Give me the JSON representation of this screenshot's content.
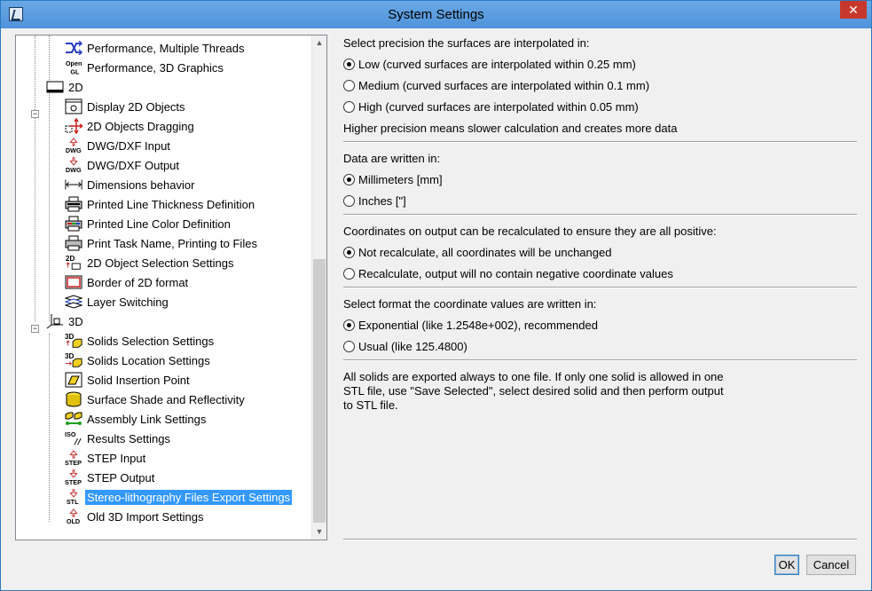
{
  "window": {
    "title": "System Settings",
    "close_glyph": "✕"
  },
  "tree": {
    "items": [
      {
        "label": "Performance, Multiple Threads",
        "icon": "threads-icon"
      },
      {
        "label": "Performance, 3D Graphics",
        "icon": "opengl-icon"
      },
      {
        "label": "2D",
        "icon": "folder-2d-icon",
        "group": true
      },
      {
        "label": "Display 2D Objects",
        "icon": "display-2d-icon"
      },
      {
        "label": "2D Objects Dragging",
        "icon": "dragging-icon"
      },
      {
        "label": "DWG/DXF Input",
        "icon": "dwg-input-icon"
      },
      {
        "label": "DWG/DXF Output",
        "icon": "dwg-output-icon"
      },
      {
        "label": "Dimensions behavior",
        "icon": "dimensions-icon"
      },
      {
        "label": "Printed Line Thickness Definition",
        "icon": "printer-icon"
      },
      {
        "label": "Printed Line Color Definition",
        "icon": "printer-color-icon"
      },
      {
        "label": "Print Task Name, Printing to Files",
        "icon": "printer-file-icon"
      },
      {
        "label": "2D Object Selection Settings",
        "icon": "selection-2d-icon"
      },
      {
        "label": "Border of 2D format",
        "icon": "border-icon"
      },
      {
        "label": "Layer Switching",
        "icon": "layers-icon"
      },
      {
        "label": "3D",
        "icon": "axes-3d-icon",
        "group": true
      },
      {
        "label": "Solids Selection Settings",
        "icon": "solid-select-icon"
      },
      {
        "label": "Solids Location Settings",
        "icon": "solid-location-icon"
      },
      {
        "label": "Solid Insertion Point",
        "icon": "insertion-point-icon"
      },
      {
        "label": "Surface Shade and Reflectivity",
        "icon": "shade-icon"
      },
      {
        "label": "Assembly Link Settings",
        "icon": "assembly-link-icon"
      },
      {
        "label": "Results Settings",
        "icon": "iso-results-icon"
      },
      {
        "label": "STEP Input",
        "icon": "step-input-icon"
      },
      {
        "label": "STEP Output",
        "icon": "step-output-icon"
      },
      {
        "label": "Stereo-lithography Files Export Settings",
        "icon": "stl-icon",
        "selected": true
      },
      {
        "label": "Old 3D Import Settings",
        "icon": "old-import-icon"
      }
    ],
    "icon_texts": {
      "opengl": "Open",
      "gl": "GL",
      "dwg": "DWG",
      "step": "STEP",
      "stl": "STL",
      "old": "OLD",
      "iso": "ISO",
      "twod": "2D",
      "threed": "3D"
    }
  },
  "precision": {
    "heading": "Select precision the surfaces are interpolated in:",
    "options": [
      "Low (curved surfaces are interpolated within 0.25 mm)",
      "Medium (curved surfaces are interpolated within 0.1 mm)",
      "High (curved surfaces are interpolated within 0.05 mm)"
    ],
    "selected": 0,
    "note": "Higher precision means slower calculation and creates more data"
  },
  "units": {
    "heading": "Data are written in:",
    "options": [
      "Millimeters [mm]",
      "Inches [\"]"
    ],
    "selected": 0
  },
  "coordinates": {
    "heading": "Coordinates on output can be recalculated to ensure they are all positive:",
    "options": [
      "Not recalculate, all coordinates will be unchanged",
      "Recalculate, output will no contain negative coordinate values"
    ],
    "selected": 0
  },
  "format": {
    "heading": "Select format the coordinate values are written in:",
    "options": [
      "Exponential (like 1.2548e+002), recommended",
      "Usual (like 125.4800)"
    ],
    "selected": 0
  },
  "info": {
    "lines": [
      "All solids are exported always to one file. If only one solid is allowed in one",
      "STL file, use \"Save Selected\", select desired solid and then perform output",
      "to STL file."
    ]
  },
  "buttons": {
    "ok": "OK",
    "cancel": "Cancel"
  },
  "colors": {
    "selection": "#3399ff",
    "title_bar": "#5b9de0",
    "close": "#c7382c"
  }
}
